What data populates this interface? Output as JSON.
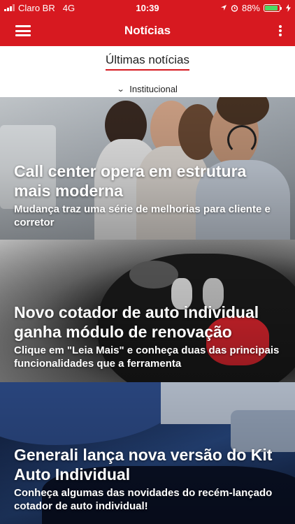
{
  "status_bar": {
    "carrier": "Claro BR",
    "network": "4G",
    "time": "10:39",
    "battery_percent": "88%",
    "battery_level": 0.88
  },
  "header": {
    "title": "Notícias"
  },
  "tabs": [
    {
      "label": "Últimas notícias",
      "active": true
    }
  ],
  "filter": {
    "label": "Institucional"
  },
  "news": [
    {
      "title": "Call center opera em estrutura mais moderna",
      "subtitle": "Mudança traz uma série de melhorias para cliente e corretor"
    },
    {
      "title": "Novo cotador de auto individual ganha módulo de renovação",
      "subtitle": "Clique em \"Leia Mais\" e conheça duas das principais funcionalidades que a ferramenta"
    },
    {
      "title": "Generali lança nova versão do Kit Auto Individual",
      "subtitle": "Conheça algumas das novidades do recém-lançado cotador de auto individual!"
    }
  ],
  "colors": {
    "brand": "#d71920",
    "battery": "#4cd964"
  },
  "icons": [
    "signal-icon",
    "location-arrow-icon",
    "alarm-icon",
    "battery-icon",
    "charging-icon",
    "hamburger-menu-icon",
    "more-vertical-icon",
    "chevron-down-icon"
  ]
}
